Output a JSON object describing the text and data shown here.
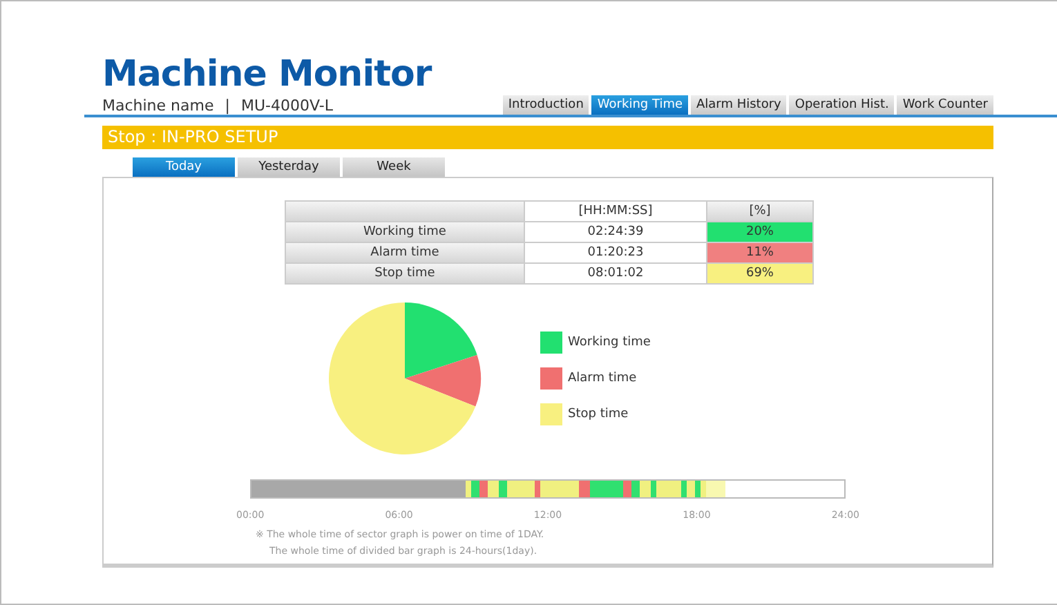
{
  "header": {
    "title": "Machine Monitor",
    "machine_label": "Machine name",
    "separator": "|",
    "machine_name": "MU-4000V-L"
  },
  "tabs": [
    {
      "label": "Introduction",
      "selected": false
    },
    {
      "label": "Working Time",
      "selected": true
    },
    {
      "label": "Alarm History",
      "selected": false
    },
    {
      "label": "Operation Hist.",
      "selected": false
    },
    {
      "label": "Work Counter",
      "selected": false
    }
  ],
  "status_bar": {
    "text": "Stop : IN-PRO SETUP"
  },
  "period_tabs": [
    {
      "label": "Today",
      "selected": true
    },
    {
      "label": "Yesterday",
      "selected": false
    },
    {
      "label": "Week",
      "selected": false
    }
  ],
  "table": {
    "columns": [
      "[HH:MM:SS]",
      "[%]"
    ],
    "rows": [
      {
        "label": "Working time",
        "time": "02:24:39",
        "percent": "20%",
        "color": "#22e070"
      },
      {
        "label": "Alarm time",
        "time": "01:20:23",
        "percent": "11%",
        "color": "#f08080"
      },
      {
        "label": "Stop time",
        "time": "08:01:02",
        "percent": "69%",
        "color": "#f8f080"
      }
    ]
  },
  "chart_data": {
    "type": "pie",
    "categories": [
      "Working time",
      "Alarm time",
      "Stop time"
    ],
    "values": [
      20,
      11,
      69
    ],
    "colors": [
      "#22e070",
      "#f07070",
      "#f8f080"
    ]
  },
  "timeline": {
    "ticks": [
      "00:00",
      "06:00",
      "12:00",
      "18:00",
      "24:00"
    ]
  },
  "notes": [
    "※ The whole time of sector graph is power on time of 1DAY.",
    "The whole time of divided bar graph is 24-hours(1day)."
  ]
}
